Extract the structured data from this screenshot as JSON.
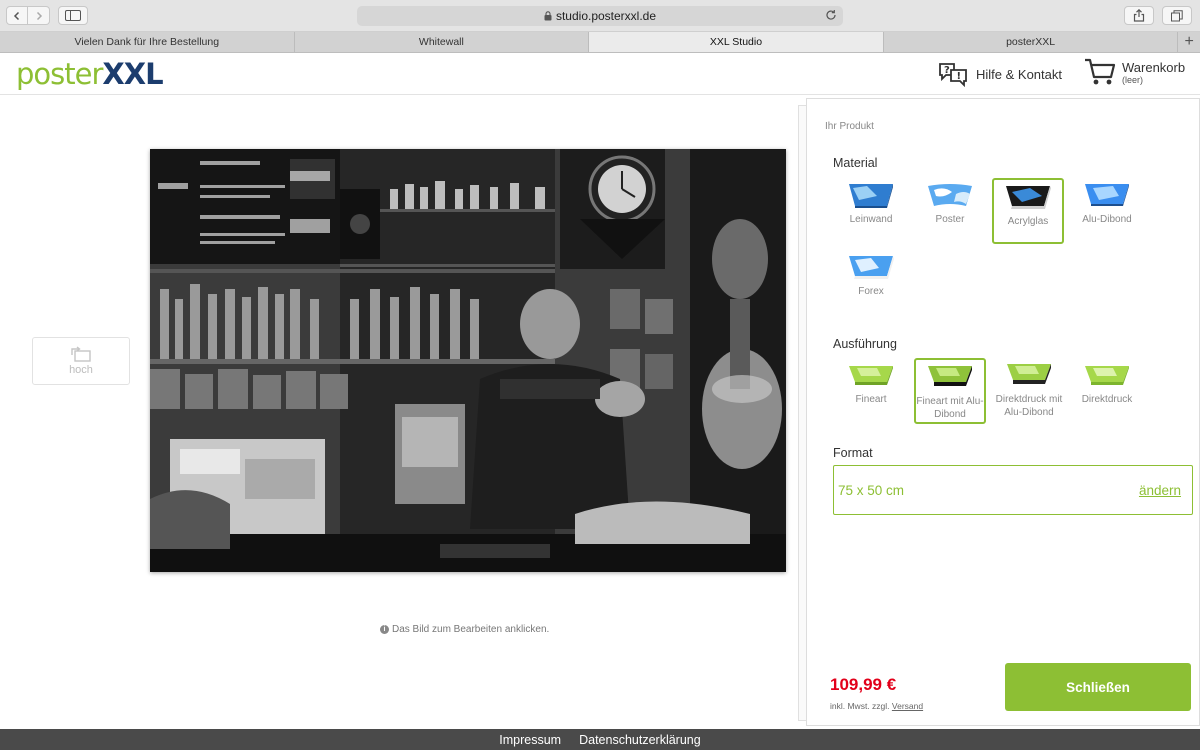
{
  "browser": {
    "url": "studio.posterxxl.de",
    "tabs": [
      {
        "label": "Vielen Dank für Ihre Bestellung"
      },
      {
        "label": "Whitewall"
      },
      {
        "label": "XXL Studio"
      },
      {
        "label": "posterXXL"
      }
    ],
    "icons": [
      "back-icon",
      "forward-icon",
      "sidebar-icon",
      "lock-icon",
      "reload-icon",
      "share-icon",
      "tabs-icon",
      "plus-icon"
    ]
  },
  "header": {
    "logo_part1": "poster",
    "logo_part2": "XXL",
    "help_label": "Hilfe & Kontakt",
    "cart_label": "Warenkorb",
    "cart_status": "(leer)"
  },
  "canvas": {
    "orientation_label": "hoch",
    "hint": "Das Bild zum Bearbeiten anklicken."
  },
  "panel": {
    "title": "Ihr Produkt",
    "material_title": "Material",
    "materials": [
      {
        "label": "Leinwand",
        "selected": false
      },
      {
        "label": "Poster",
        "selected": false
      },
      {
        "label": "Acrylglas",
        "selected": true
      },
      {
        "label": "Alu-Dibond",
        "selected": false
      },
      {
        "label": "Forex",
        "selected": false
      }
    ],
    "execution_title": "Ausführung",
    "executions": [
      {
        "label": "Fineart",
        "selected": false
      },
      {
        "label": "Fineart mit Alu-Dibond",
        "selected": true
      },
      {
        "label": "Direktdruck mit Alu-Dibond",
        "selected": false
      },
      {
        "label": "Direktdruck",
        "selected": false
      }
    ],
    "format_title": "Format",
    "format_value": "75 x 50 cm",
    "format_change": "ändern",
    "price": "109,99 €",
    "price_note": "inkl. Mwst. zzgl.",
    "shipping_link": "Versand",
    "close_label": "Schließen"
  },
  "footer": {
    "links": [
      {
        "label": "Impressum"
      },
      {
        "label": "Datenschutzerklärung"
      }
    ]
  },
  "colors": {
    "brand_green": "#8dbf34",
    "brand_navy": "#1c3d6e",
    "price_red": "#e2001a",
    "footer_bg": "#4a4a4a"
  }
}
